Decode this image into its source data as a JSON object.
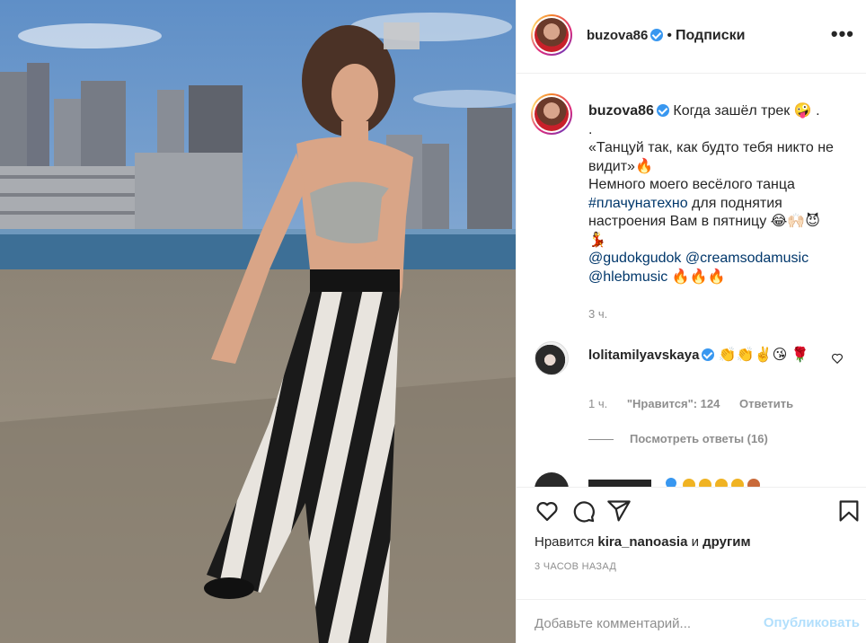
{
  "post": {
    "username": "buzova86",
    "follow_label": "Подписки",
    "more_label": "•••",
    "caption": {
      "username": "buzova86",
      "line1": "Когда зашёл трек 🤪 .",
      "line2": ".",
      "line3": "«Танцуй так, как будто тебя никто не видит»🔥",
      "line4": "Немного моего весёлого танца",
      "hashtag": "#плачунатехно",
      "line5_rest": " для поднятия настроения Вам в пятницу 😂🙌🏻😈",
      "line6": "💃",
      "mentions1a": "@gudokgudok",
      "mentions1b": "@creamsodamusic",
      "mentions2": "@hlebmusic",
      "mentions2_emoji": " 🔥🔥🔥",
      "time": "3 ч."
    },
    "comment": {
      "username": "lolitamilyavskaya",
      "text": "👏👏✌️😘 🌹",
      "time": "1 ч.",
      "likes": "\"Нравится\": 124",
      "reply": "Ответить",
      "view_replies": "Посмотреть ответы (16)"
    },
    "liked_by_prefix": "Нравится ",
    "liked_by_user": "kira_nanoasia",
    "liked_by_suffix": " и ",
    "liked_by_others": "другим",
    "timestamp": "3 ЧАСОВ НАЗАД",
    "comment_placeholder": "Добавьте комментарий...",
    "publish_label": "Опубликовать"
  },
  "icons": {
    "like": "heart-icon",
    "comment": "comment-icon",
    "share": "share-icon",
    "save": "bookmark-icon"
  },
  "colors": {
    "link": "#00376b",
    "verified": "#3897f0",
    "muted": "#8e8e8e",
    "publish_disabled": "#b2dffc"
  }
}
